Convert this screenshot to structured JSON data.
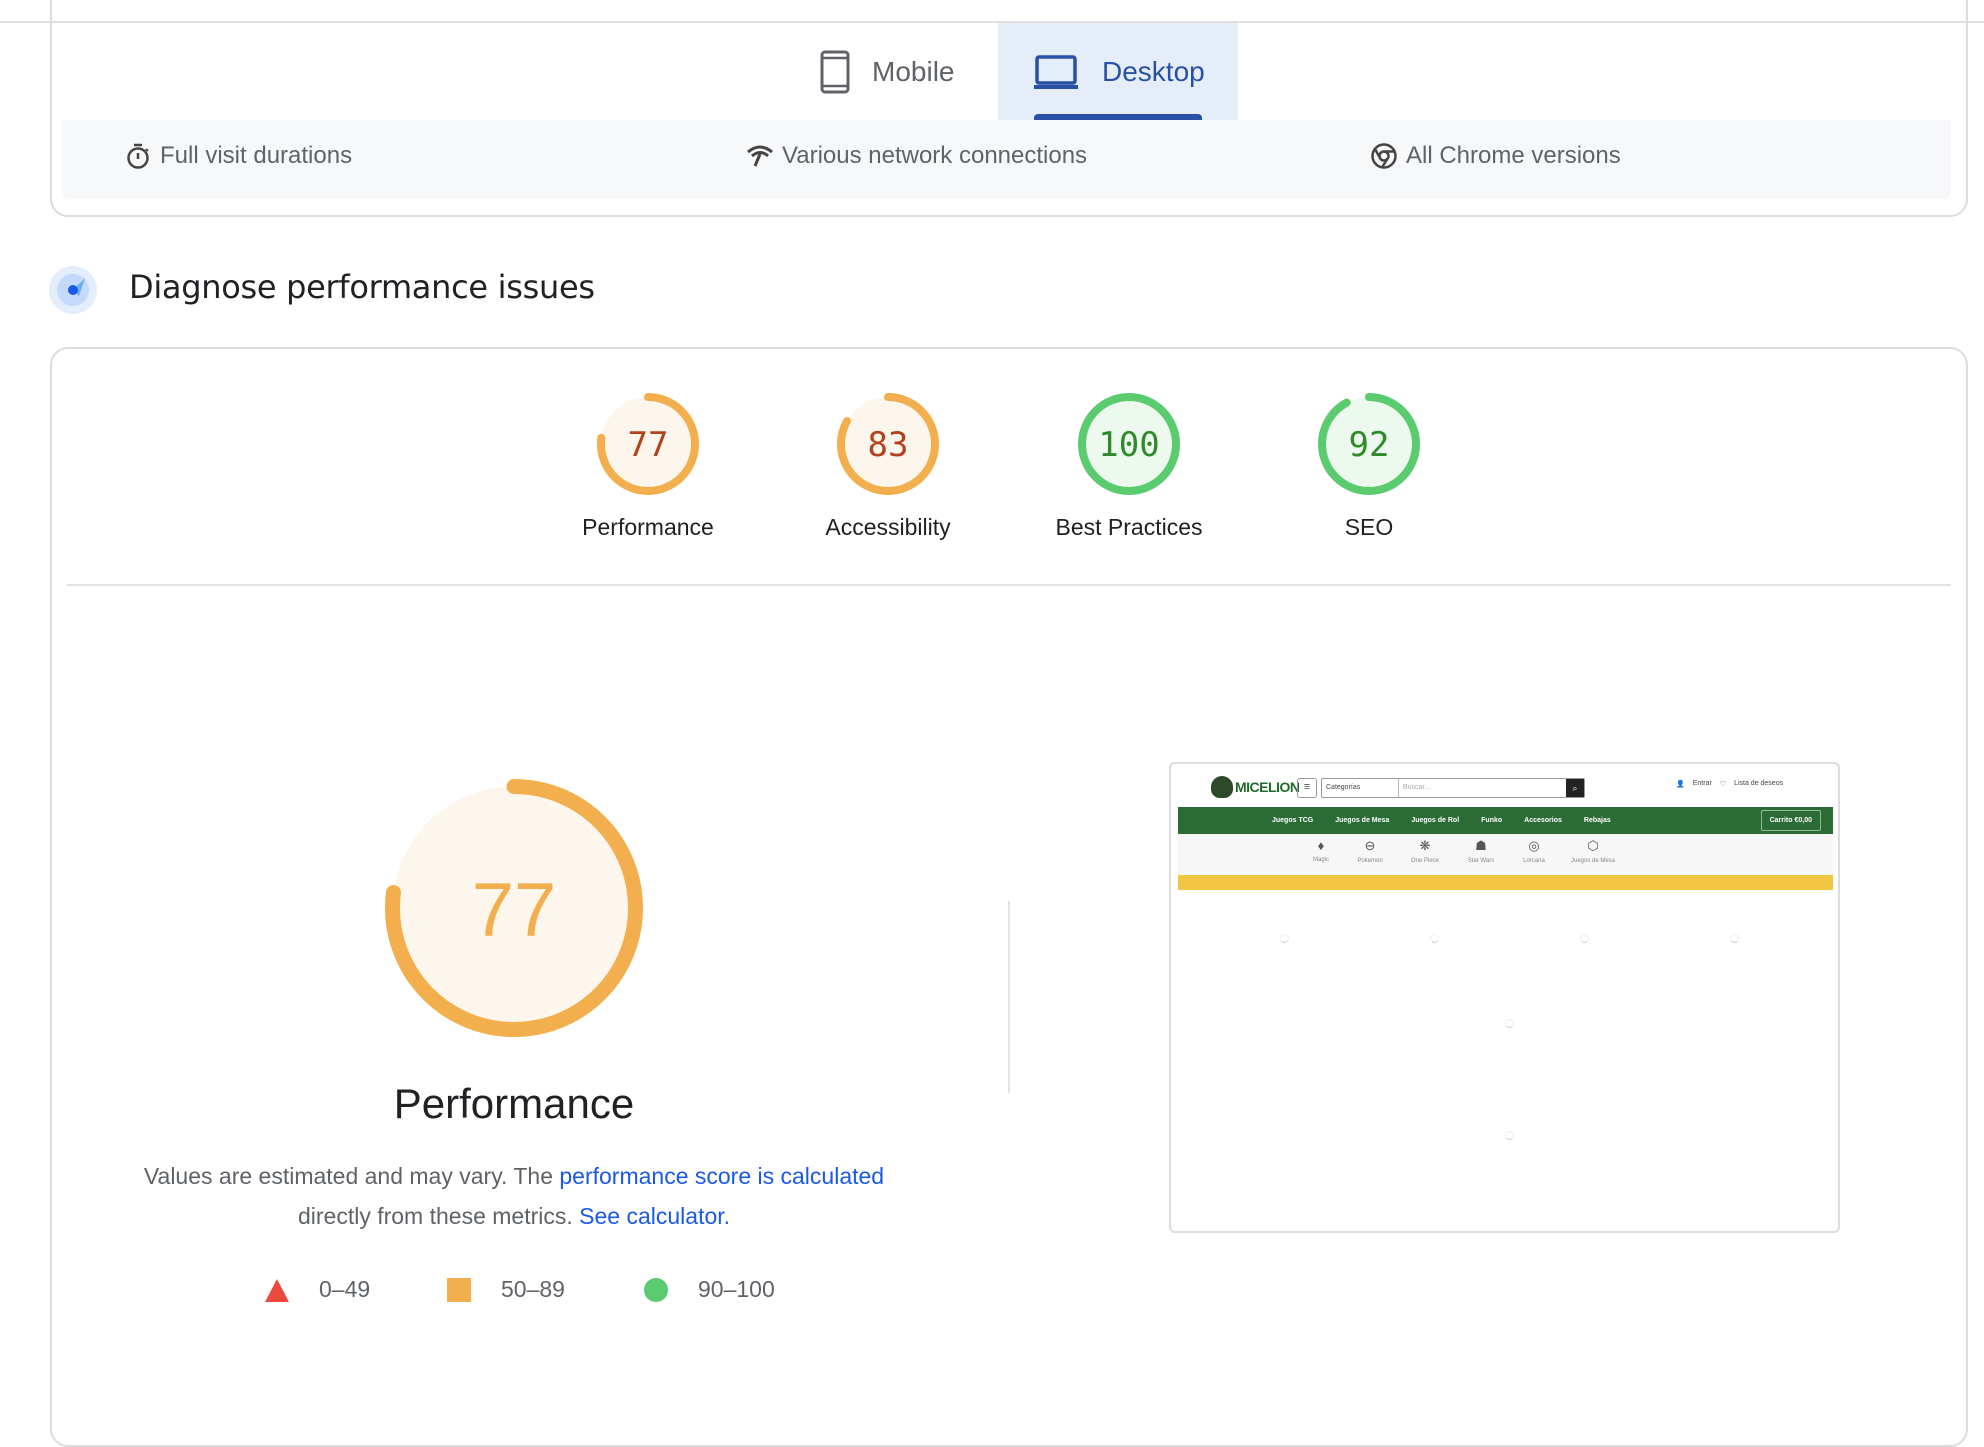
{
  "device_tabs": [
    {
      "label": "Mobile",
      "icon": "smartphone-icon",
      "selected": false
    },
    {
      "label": "Desktop",
      "icon": "laptop-icon",
      "selected": true
    }
  ],
  "field_data_info": [
    {
      "icon": "stopwatch-icon",
      "label": "Full visit durations"
    },
    {
      "icon": "network-icon",
      "label": "Various network connections"
    },
    {
      "icon": "chrome-icon",
      "label": "All Chrome versions"
    }
  ],
  "diagnose": {
    "title": "Diagnose performance issues"
  },
  "scores": [
    {
      "label": "Performance",
      "value": 77,
      "rating": "average"
    },
    {
      "label": "Accessibility",
      "value": 83,
      "rating": "average"
    },
    {
      "label": "Best Practices",
      "value": 100,
      "rating": "pass"
    },
    {
      "label": "SEO",
      "value": 92,
      "rating": "pass"
    }
  ],
  "colors": {
    "average_stroke": "#f3ae4e",
    "average_fill": "#fdf6ec",
    "average_text": "#b3421c",
    "average_big_text": "#f3ae4e",
    "pass_stroke": "#5acb6e",
    "pass_fill": "#edf9ef",
    "pass_text": "#2f8a2a",
    "fail": "#eb4a3f",
    "link": "#1a59e8",
    "tab_active": "#2750a6"
  },
  "performance_detail": {
    "score": 77,
    "title": "Performance",
    "desc_prefix": "Values are estimated and may vary. The ",
    "desc_link1": "performance score is calculated",
    "desc_middle": " directly from these metrics. ",
    "desc_link2": "See calculator."
  },
  "legend": [
    {
      "shape": "triangle",
      "range": "0–49"
    },
    {
      "shape": "square",
      "range": "50–89"
    },
    {
      "shape": "circle",
      "range": "90–100"
    }
  ],
  "thumbnail": {
    "logo_text": "MICELION",
    "search_category": "Categorías",
    "search_placeholder": "Buscar...",
    "account": "Entrar",
    "wishlist": "Lista de deseos",
    "nav": [
      "Juegos TCG",
      "Juegos de Mesa",
      "Juegos de Rol",
      "Funko",
      "Accesorios",
      "Rebajas"
    ],
    "cart": "Carrito €0,00",
    "categories": [
      "Magic",
      "Pokemon",
      "One Piece",
      "Star Wars",
      "Lorcana",
      "Juegos de Mesa"
    ]
  }
}
